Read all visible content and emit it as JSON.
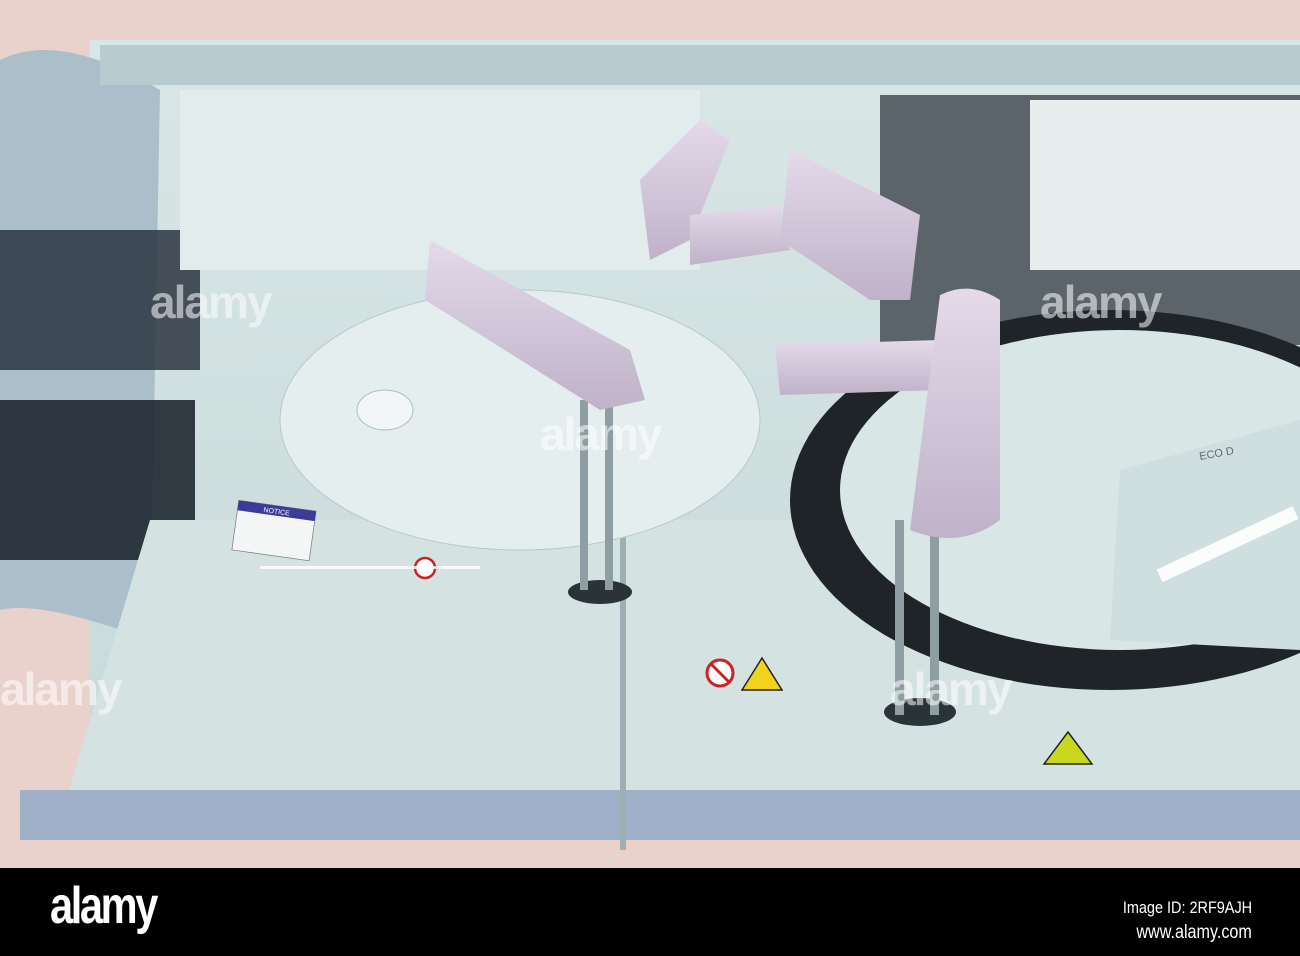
{
  "photo": {
    "subject": "automated analyzer interior",
    "labels": {
      "notice": "NOTICE",
      "carousel_text": "ECO D"
    },
    "colors": {
      "frame": "#e9d2cb",
      "interior": "#cfe0df",
      "arm": "#d8cde0",
      "glass": "#a9bcc6"
    }
  },
  "watermark": {
    "text": "alamy"
  },
  "strip": {
    "logo": "alamy",
    "image_id": "Image ID: 2RF9AJH",
    "url": "www.alamy.com"
  }
}
